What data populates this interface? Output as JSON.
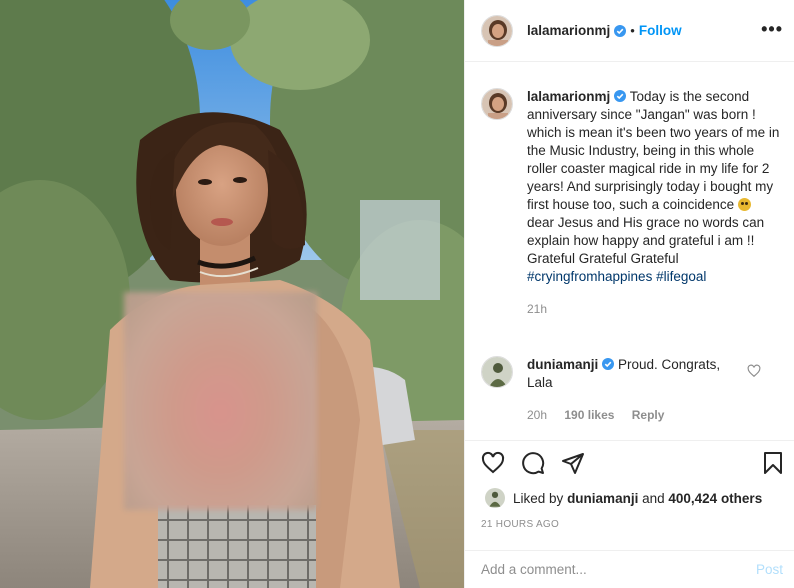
{
  "post": {
    "author": "lalamarionmj",
    "follow_label": "Follow",
    "dot": "•",
    "more_label": "•••"
  },
  "caption": {
    "username": "lalamarionmj",
    "text_1": " Today is the second anniversary since \"Jangan\" was born ! which is mean it's been two years of me in the Music Industry, being in this whole roller coaster magical ride in my life for 2 years! And surprisingly today i bought my first house too, such a coincidence ",
    "text_2": " dear Jesus and His grace no words can explain how happy and grateful i am !! Grateful Grateful Grateful ",
    "hashtag_1": "#cryingfromhappines",
    "hashtag_2": "#lifegoal",
    "time": "21h"
  },
  "comment": {
    "username": "duniamanji",
    "text": " Proud. Congrats, Lala",
    "time": "20h",
    "likes": "190 likes",
    "reply_label": "Reply"
  },
  "likes": {
    "prefix": "Liked by ",
    "user": "duniamanji",
    "middle": " and ",
    "count": "400,424 others"
  },
  "timestamp": "21 HOURS AGO",
  "add_comment": {
    "placeholder": "Add a comment...",
    "post_label": "Post"
  },
  "colors": {
    "accent": "#0095f6",
    "hashtag": "#00376b",
    "muted": "#8e8e8e",
    "post_disabled": "#b2dffc"
  },
  "icons": [
    "verified-badge-icon",
    "heart-icon",
    "comment-icon",
    "share-icon",
    "bookmark-icon",
    "more-options-icon"
  ]
}
